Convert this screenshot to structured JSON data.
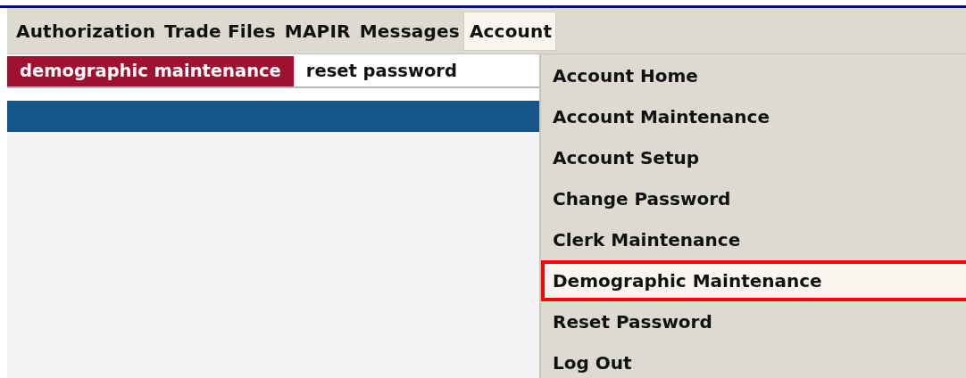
{
  "menu_bar": [
    {
      "label": "Authorization",
      "selected": false
    },
    {
      "label": "Trade Files",
      "selected": false
    },
    {
      "label": "MAPIR",
      "selected": false
    },
    {
      "label": "Messages",
      "selected": false
    },
    {
      "label": "Account",
      "selected": true
    }
  ],
  "tabs": [
    {
      "label": "demographic maintenance",
      "selected": true
    },
    {
      "label": "reset password",
      "selected": false
    }
  ],
  "dropdown": {
    "items": [
      {
        "label": "Account Home",
        "selected": false
      },
      {
        "label": "Account Maintenance",
        "selected": false
      },
      {
        "label": "Account Setup",
        "selected": false
      },
      {
        "label": "Change Password",
        "selected": false
      },
      {
        "label": "Clerk Maintenance",
        "selected": false
      },
      {
        "label": "Demographic Maintenance",
        "selected": true
      },
      {
        "label": "Reset Password",
        "selected": false
      },
      {
        "label": "Log Out",
        "selected": false
      }
    ]
  }
}
